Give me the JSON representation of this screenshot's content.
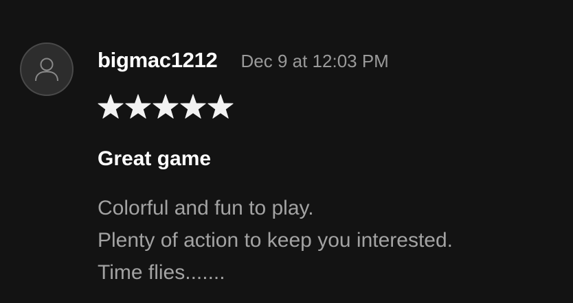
{
  "review": {
    "avatar_icon": "user-icon",
    "username": "bigmac1212",
    "timestamp": "Dec 9 at 12:03 PM",
    "rating": 5,
    "rating_max": 5,
    "title": "Great game",
    "body_lines": [
      "Colorful and fun to play.",
      "Plenty of action to keep you interested.",
      "Time flies......."
    ]
  },
  "colors": {
    "background": "#131313",
    "star": "#f2f2f2",
    "username": "#ffffff",
    "timestamp": "#9a9a9a",
    "body": "#a3a3a3"
  }
}
